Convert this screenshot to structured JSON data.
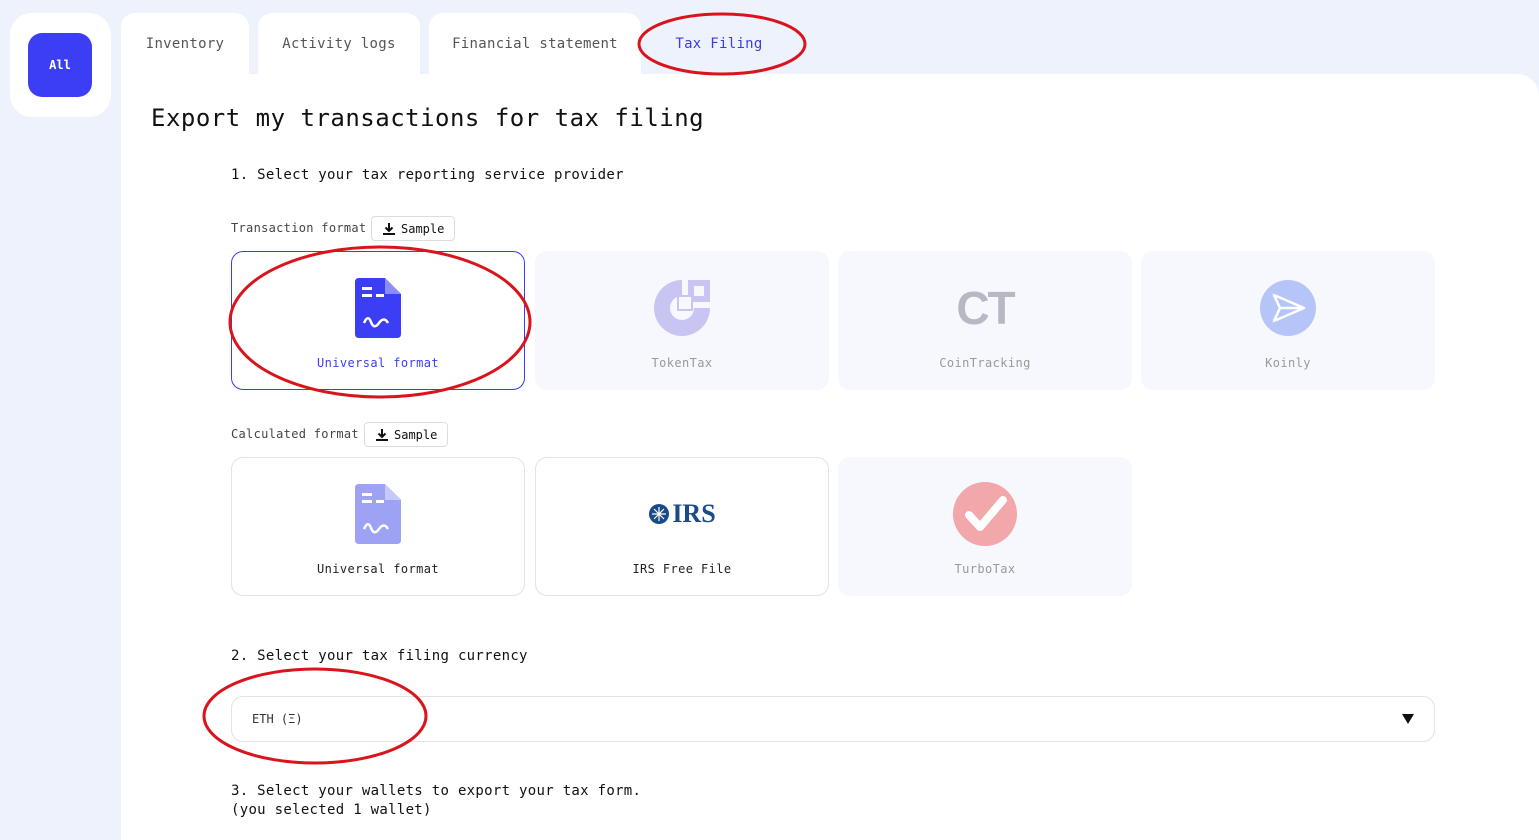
{
  "sidebar": {
    "all_label": "All"
  },
  "tabs": [
    {
      "label": "Inventory"
    },
    {
      "label": "Activity logs"
    },
    {
      "label": "Financial statement"
    },
    {
      "label": "Tax Filing"
    }
  ],
  "main": {
    "title": "Export my transactions for tax filing",
    "step1": "1. Select your tax reporting service provider",
    "transaction_format_label": "Transaction format",
    "calculated_format_label": "Calculated format",
    "sample_label": "Sample",
    "transaction_cards": [
      {
        "label": "Universal format",
        "icon": "document-signature-icon",
        "selected": true
      },
      {
        "label": "TokenTax",
        "icon": "tokentax-logo",
        "enabled": false
      },
      {
        "label": "CoinTracking",
        "icon": "cointracking-logo",
        "enabled": false
      },
      {
        "label": "Koinly",
        "icon": "koinly-logo",
        "enabled": false
      }
    ],
    "calculated_cards": [
      {
        "label": "Universal format",
        "icon": "document-signature-icon"
      },
      {
        "label": "IRS Free File",
        "icon": "irs-logo"
      },
      {
        "label": "TurboTax",
        "icon": "turbotax-logo",
        "enabled": false
      }
    ],
    "step2": "2. Select your tax filing currency",
    "currency_value": "ETH (Ξ)",
    "step3_line1": "3. Select your wallets to export your tax form.",
    "step3_line2": "(you selected 1 wallet)"
  },
  "logo_text": {
    "cointracking": "CT",
    "irs": "IRS"
  },
  "colors": {
    "accent": "#3b3ef5",
    "annotation": "#d9141c",
    "background": "#eef2fc"
  }
}
